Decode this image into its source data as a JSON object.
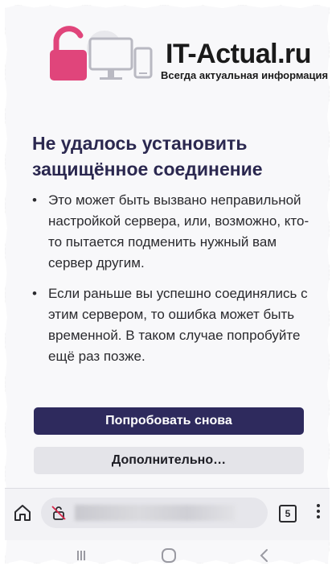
{
  "watermark": {
    "title": "IT-Actual.ru",
    "tagline": "Всегда актуальная информация",
    "icon": "broken-lock-computer-logo"
  },
  "error": {
    "heading": "Не удалось установить защищённое соединение",
    "bullets": [
      "Это может быть вызвано неправильной настройкой сервера, или, возможно, кто-то пытается подменить нужный вам сервер другим.",
      "Если раньше вы успешно соединялись с этим сервером, то ошибка может быть временной. В таком случае попробуйте ещё раз позже."
    ],
    "bullet_symbol": "•",
    "retry_label": "Попробовать снова",
    "advanced_label": "Дополнительно…"
  },
  "toolbar": {
    "home_icon": "home-icon",
    "lock_icon": "broken-lock-icon",
    "url": "",
    "tab_count": "5",
    "menu_icon": "kebab-menu-icon"
  },
  "navbar": {
    "recents_icon": "recents-icon",
    "home_icon": "home-circle-icon",
    "back_icon": "back-chevron-icon"
  },
  "colors": {
    "heading": "#2b2850",
    "primary_button": "#2e2a5d",
    "secondary_button": "#e4e4e9",
    "logo_lock": "#e0457b"
  }
}
